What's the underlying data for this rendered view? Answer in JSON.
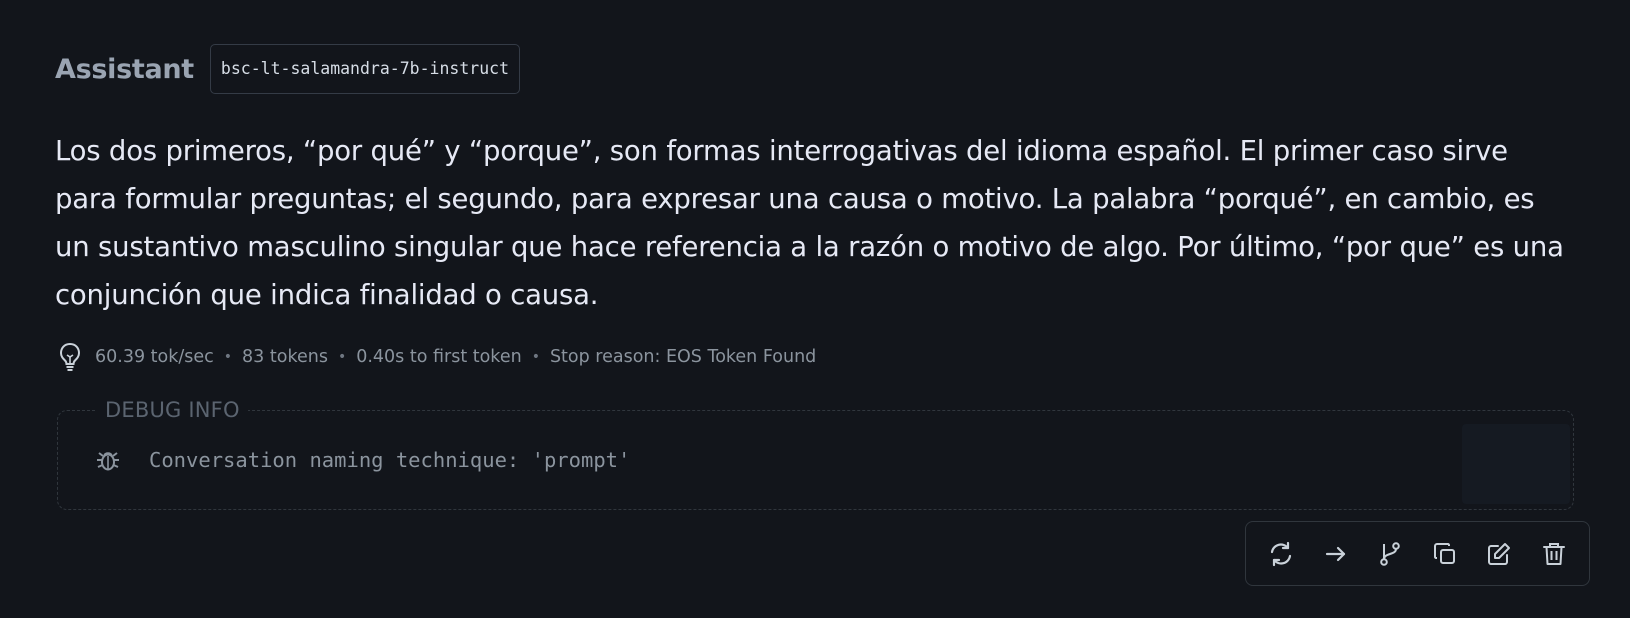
{
  "header": {
    "role": "Assistant",
    "model": "bsc-lt-salamandra-7b-instruct"
  },
  "message": {
    "text": "Los dos primeros, “por qué” y “porque”, son formas interrogativas del idioma español. El primer caso sirve para formular preguntas; el segundo, para expresar una causa o motivo. La palabra “porqué”, en cambio, es un sustantivo masculino singular que hace referencia a la razón o motivo de algo. Por último, “por que” es una conjunción que indica finalidad o causa."
  },
  "stats": {
    "speed": "60.39 tok/sec",
    "tokens": "83 tokens",
    "first_token": "0.40s to first token",
    "stop_reason": "Stop reason: EOS Token Found",
    "separator": "•"
  },
  "debug": {
    "title": "DEBUG INFO",
    "line": "Conversation naming technique: 'prompt'"
  },
  "actions": {
    "icons": [
      "regenerate-icon",
      "continue-icon",
      "branch-icon",
      "copy-icon",
      "edit-icon",
      "delete-icon"
    ]
  },
  "colors": {
    "background": "#12151b",
    "text": "#e6e9f5",
    "muted": "#8b949e",
    "border": "#30363d"
  }
}
